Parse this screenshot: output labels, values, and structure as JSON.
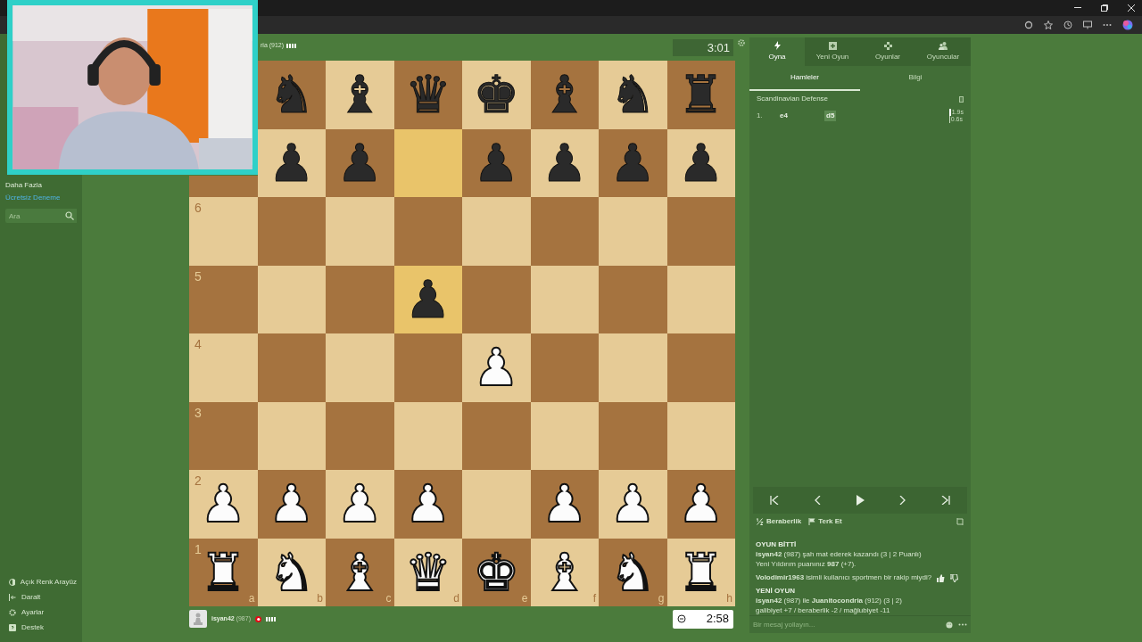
{
  "sidebar": {
    "top_items": [
      "Daha Fazla",
      "Ücretsiz Deneme"
    ],
    "search": {
      "placeholder": "Ara"
    },
    "bottom_items": [
      {
        "kind": "theme",
        "label": "Açık Renk Arayüz"
      },
      {
        "kind": "collapse",
        "label": "Daralt"
      },
      {
        "kind": "settings",
        "label": "Ayarlar"
      },
      {
        "kind": "help",
        "label": "Destek"
      }
    ]
  },
  "opponent": {
    "name": "ria (912)",
    "clock": "3:01"
  },
  "board": {
    "files": [
      "a",
      "b",
      "c",
      "d",
      "e",
      "f",
      "g",
      "h"
    ],
    "ranks": [
      {
        "squares": [
          {
            "piece": "♞",
            "kind": "black",
            "highlight": false
          },
          {
            "piece": "♝",
            "kind": "black",
            "highlight": false
          },
          {
            "piece": "♛",
            "kind": "black",
            "highlight": false
          },
          {
            "piece": "♚",
            "kind": "black",
            "highlight": false
          },
          {
            "piece": "♝",
            "kind": "black",
            "highlight": false
          },
          {
            "piece": "♞",
            "kind": "black",
            "highlight": false
          },
          {
            "piece": "♜",
            "kind": "black",
            "highlight": false
          }
        ]
      },
      {
        "squares": [
          {
            "highlight": false
          },
          {
            "piece": "♟",
            "kind": "black",
            "highlight": false
          },
          {
            "piece": "♟",
            "kind": "black",
            "highlight": false
          },
          {
            "highlight": true
          },
          {
            "piece": "♟",
            "kind": "black",
            "highlight": false
          },
          {
            "piece": "♟",
            "kind": "black",
            "highlight": false
          },
          {
            "piece": "♟",
            "kind": "black",
            "highlight": false
          },
          {
            "piece": "♟",
            "kind": "black",
            "highlight": false
          }
        ]
      },
      {
        "label": "6",
        "squares": [
          {
            "highlight": false
          },
          {
            "highlight": false
          },
          {
            "highlight": false
          },
          {
            "highlight": false
          },
          {
            "highlight": false
          },
          {
            "highlight": false
          },
          {
            "highlight": false
          },
          {
            "highlight": false
          }
        ]
      },
      {
        "label": "5",
        "squares": [
          {
            "highlight": false
          },
          {
            "highlight": false
          },
          {
            "highlight": false
          },
          {
            "piece": "♟",
            "kind": "black",
            "highlight": true
          },
          {
            "highlight": false
          },
          {
            "highlight": false
          },
          {
            "highlight": false
          },
          {
            "highlight": false
          }
        ]
      },
      {
        "label": "4",
        "squares": [
          {
            "highlight": false
          },
          {
            "highlight": false
          },
          {
            "highlight": false
          },
          {
            "highlight": false
          },
          {
            "piece": "♟",
            "kind": "white",
            "highlight": false
          },
          {
            "highlight": false
          },
          {
            "highlight": false
          },
          {
            "highlight": false
          }
        ]
      },
      {
        "label": "3",
        "squares": [
          {
            "highlight": false
          },
          {
            "highlight": false
          },
          {
            "highlight": false
          },
          {
            "highlight": false
          },
          {
            "highlight": false
          },
          {
            "highlight": false
          },
          {
            "highlight": false
          },
          {
            "highlight": false
          }
        ]
      },
      {
        "label": "2",
        "squares": [
          {
            "piece": "♟",
            "kind": "white",
            "highlight": false
          },
          {
            "piece": "♟",
            "kind": "white",
            "highlight": false
          },
          {
            "piece": "♟",
            "kind": "white",
            "highlight": false
          },
          {
            "piece": "♟",
            "kind": "white",
            "highlight": false
          },
          {
            "highlight": false
          },
          {
            "piece": "♟",
            "kind": "white",
            "highlight": false
          },
          {
            "piece": "♟",
            "kind": "white",
            "highlight": false
          },
          {
            "piece": "♟",
            "kind": "white",
            "highlight": false
          }
        ]
      },
      {
        "label": "1",
        "squares": [
          {
            "piece": "♜",
            "kind": "white",
            "highlight": false
          },
          {
            "piece": "♞",
            "kind": "white",
            "highlight": false
          },
          {
            "piece": "♝",
            "kind": "white",
            "highlight": false
          },
          {
            "piece": "♛",
            "kind": "white",
            "highlight": false
          },
          {
            "piece": "♚",
            "kind": "white",
            "highlight": false
          },
          {
            "piece": "♝",
            "kind": "white",
            "highlight": false
          },
          {
            "piece": "♞",
            "kind": "white",
            "highlight": false
          },
          {
            "piece": "♜",
            "kind": "white",
            "highlight": false
          }
        ]
      }
    ]
  },
  "player": {
    "name": "isyan42",
    "rating": "(987)",
    "clock": "2:58"
  },
  "nav_tabs": [
    {
      "kind": "play",
      "label": "Oyna",
      "selected": true
    },
    {
      "kind": "new",
      "label": "Yeni Oyun",
      "selected": false
    },
    {
      "kind": "games",
      "label": "Oyunlar",
      "selected": false
    },
    {
      "kind": "players",
      "label": "Oyuncular",
      "selected": false
    }
  ],
  "sub_tabs": [
    {
      "label": "Hamleler",
      "selected": true
    },
    {
      "label": "Bilgi",
      "selected": false
    }
  ],
  "opening": "Scandinavian Defense",
  "moves": [
    {
      "number": "1.",
      "white": "e4",
      "black": "d5",
      "white_time": "1.9s",
      "black_time": "0.6s"
    }
  ],
  "actions": [
    {
      "kind": "draw",
      "label": "Beraberlik"
    },
    {
      "kind": "resign",
      "label": "Terk Et"
    }
  ],
  "chat": [
    {
      "kind": "heading",
      "text": "OYUN BİTTİ"
    },
    {
      "kind": "line",
      "text": "**isyan42** (987) şah mat ederek kazandı (3 | 2 Puanlı)"
    },
    {
      "kind": "line",
      "text": "Yeni Yıldırım puanınız **987** (+7)."
    },
    {
      "kind": "vote",
      "text": "**Volodimir1963** isimli kullanıcı sportmen bir rakip miydi?"
    },
    {
      "kind": "heading",
      "text": "YENİ OYUN"
    },
    {
      "kind": "line",
      "text": "**isyan42** (987) ile **Juanitocondria** (912) (3 | 2)"
    },
    {
      "kind": "line",
      "text": "galibiyet +7 / beraberlik -2 / mağlubiyet -11"
    }
  ],
  "chat_input": {
    "placeholder": "Bir mesaj yollayın..."
  }
}
